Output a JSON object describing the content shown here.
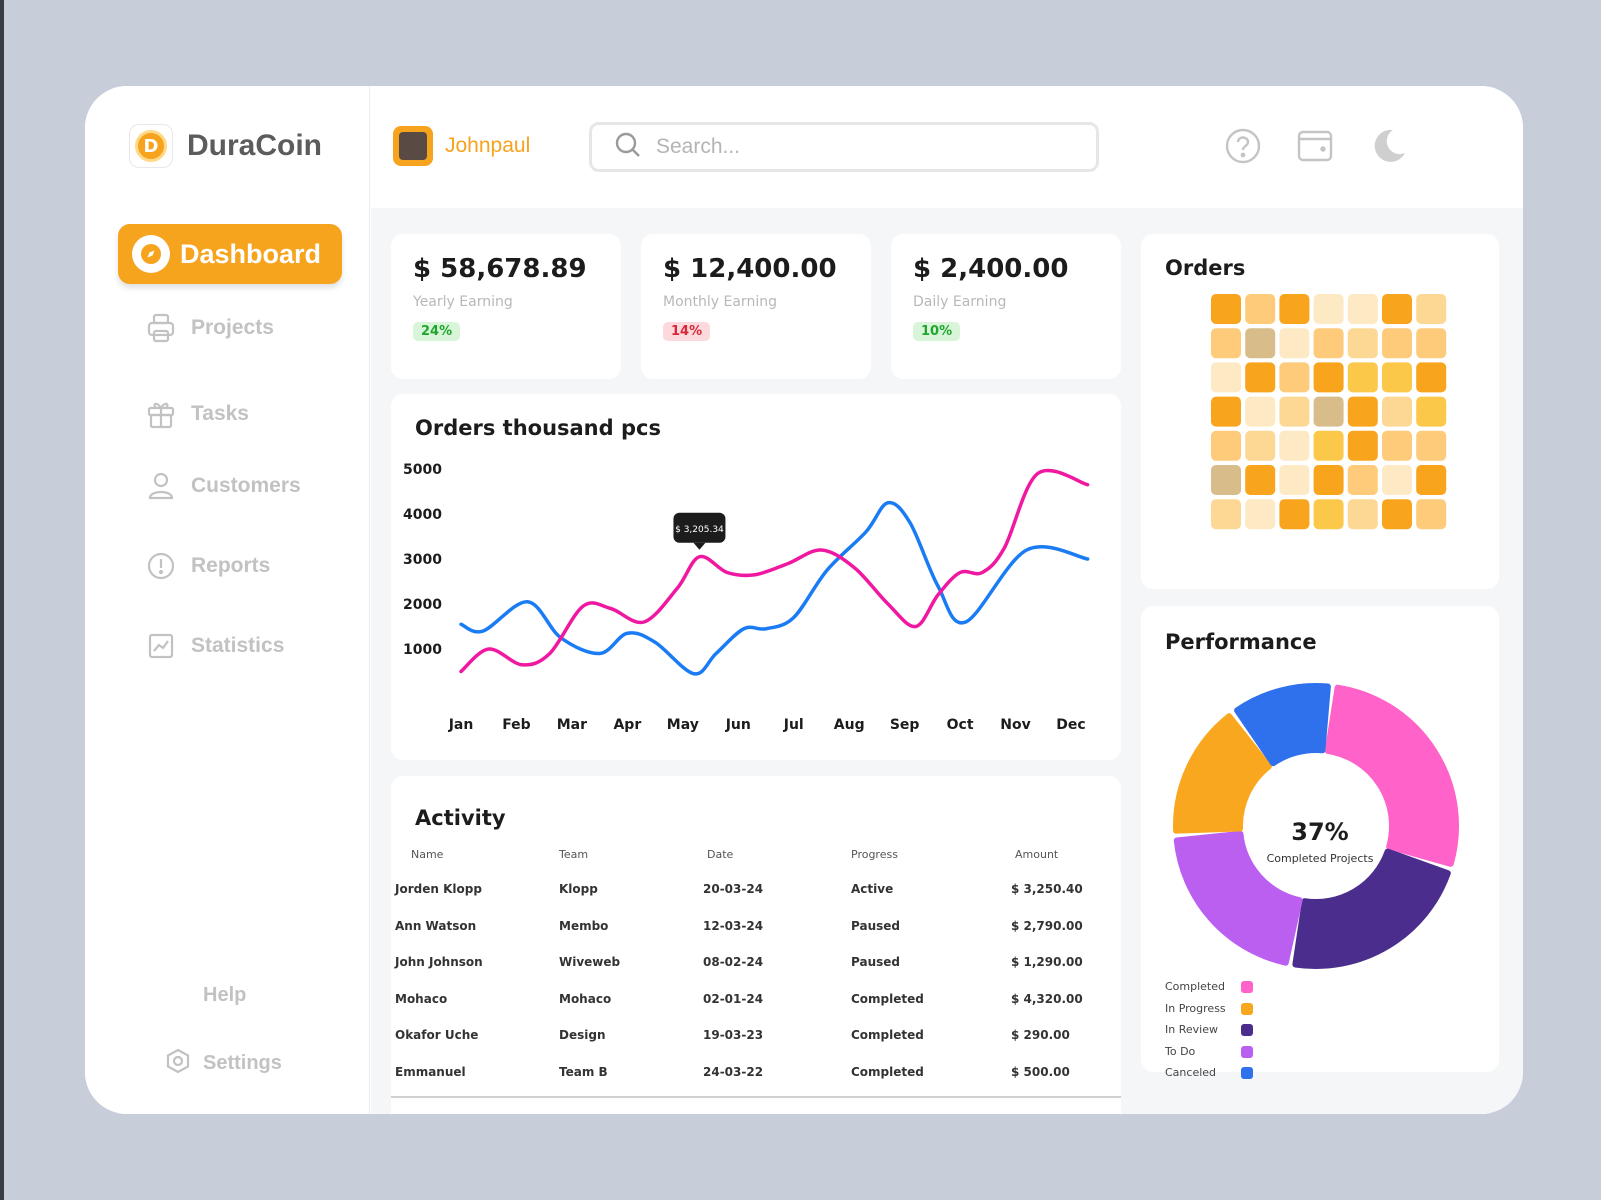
{
  "app": {
    "brand": "DuraCoin",
    "brand_letter": "D"
  },
  "sidebar": {
    "active": {
      "label": "Dashboard"
    },
    "items": [
      {
        "label": "Projects",
        "icon": "printer-icon"
      },
      {
        "label": "Tasks",
        "icon": "gift-icon"
      },
      {
        "label": "Customers",
        "icon": "user-icon"
      },
      {
        "label": "Reports",
        "icon": "alert-circle-icon"
      },
      {
        "label": "Statistics",
        "icon": "chart-icon"
      }
    ],
    "help": "Help",
    "settings": "Settings"
  },
  "header": {
    "user_name": "Johnpaul",
    "search_placeholder": "Search...",
    "icons": [
      "help-icon",
      "wallet-icon",
      "moon-icon"
    ]
  },
  "stats": [
    {
      "value": "$ 58,678.89",
      "label": "Yearly Earning",
      "change": "24%",
      "trend": "up"
    },
    {
      "value": "$ 12,400.00",
      "label": "Monthly Earning",
      "change": "14%",
      "trend": "down"
    },
    {
      "value": "$ 2,400.00",
      "label": "Daily Earning",
      "change": "10%",
      "trend": "up"
    }
  ],
  "orders_heatmap": {
    "title": "Orders",
    "palette": [
      "#fde9c4",
      "#fdd894",
      "#fecb7a",
      "#f8a41c",
      "#fcc84a",
      "#d8bc8a"
    ],
    "cells": [
      [
        3,
        2,
        3,
        0,
        0,
        3,
        1
      ],
      [
        2,
        5,
        0,
        2,
        1,
        2,
        2
      ],
      [
        0,
        3,
        2,
        3,
        4,
        4,
        3
      ],
      [
        3,
        0,
        1,
        5,
        3,
        1,
        4
      ],
      [
        2,
        1,
        0,
        4,
        3,
        2,
        2
      ],
      [
        5,
        3,
        0,
        3,
        2,
        0,
        3
      ],
      [
        1,
        0,
        3,
        4,
        1,
        3,
        2
      ]
    ]
  },
  "chart_data": {
    "type": "line",
    "title": "Orders thousand pcs",
    "categories": [
      "Jan",
      "Feb",
      "Mar",
      "Apr",
      "May",
      "Jun",
      "Jul",
      "Aug",
      "Sep",
      "Oct",
      "Nov",
      "Dec"
    ],
    "y_ticks": [
      5000,
      4000,
      3000,
      2000,
      1000
    ],
    "ylim": [
      0,
      5000
    ],
    "series": [
      {
        "color": "#1a7cf5",
        "x": [
          0,
          0.4,
          1.2,
          1.8,
          2.5,
          3.0,
          3.5,
          4.2,
          4.6,
          5.1,
          5.5,
          6.0,
          6.6,
          7.3,
          7.7,
          8.1,
          8.6,
          9.1,
          10.2,
          11.3
        ],
        "values": [
          1550,
          1400,
          2050,
          1250,
          900,
          1350,
          1150,
          450,
          900,
          1450,
          1450,
          1700,
          2750,
          3600,
          4250,
          3800,
          2400,
          1600,
          3200,
          3000
        ]
      },
      {
        "color": "#f018a0",
        "x": [
          0,
          0.5,
          1.1,
          1.6,
          2.2,
          2.7,
          3.3,
          3.9,
          4.3,
          4.8,
          5.3,
          5.9,
          6.5,
          7.1,
          7.7,
          8.2,
          8.6,
          9.0,
          9.4,
          9.8,
          10.4,
          11.3
        ],
        "values": [
          500,
          1000,
          650,
          900,
          1950,
          1900,
          1600,
          2350,
          3050,
          2700,
          2650,
          2900,
          3200,
          2800,
          2000,
          1500,
          2200,
          2700,
          2700,
          3250,
          4900,
          4650
        ]
      }
    ],
    "tooltip": {
      "text": "$ 3,205.34",
      "x": 4.3,
      "y": 3050
    }
  },
  "activity": {
    "title": "Activity",
    "columns": [
      "Name",
      "Team",
      "Date",
      "Progress",
      "Amount"
    ],
    "rows": [
      [
        "Jorden Klopp",
        "Klopp",
        "20-03-24",
        "Active",
        "$ 3,250.40"
      ],
      [
        "Ann Watson",
        "Membo",
        "12-03-24",
        "Paused",
        "$ 2,790.00"
      ],
      [
        "John Johnson",
        "Wiveweb",
        "08-02-24",
        "Paused",
        "$ 1,290.00"
      ],
      [
        "Mohaco",
        "Mohaco",
        "02-01-24",
        "Completed",
        "$ 4,320.00"
      ],
      [
        "Okafor Uche",
        "Design",
        "19-03-23",
        "Completed",
        "$ 290.00"
      ],
      [
        "Emmanuel",
        "Team B",
        "24-03-22",
        "Completed",
        "$ 500.00"
      ]
    ]
  },
  "performance": {
    "title": "Performance",
    "center_value": "37%",
    "center_label": "Completed Projects",
    "segments": [
      {
        "label": "Completed",
        "color": "#ff62c8",
        "value": 28
      },
      {
        "label": "In Review",
        "color": "#4b2d8e",
        "value": 23
      },
      {
        "label": "To Do",
        "color": "#bb5ff0",
        "value": 21
      },
      {
        "label": "In Progress",
        "color": "#f9a71f",
        "value": 16
      },
      {
        "label": "Canceled",
        "color": "#2f71ec",
        "value": 12
      }
    ],
    "legend": [
      {
        "label": "Completed",
        "color": "#ff62c8"
      },
      {
        "label": "In Progress",
        "color": "#f9a71f"
      },
      {
        "label": "In Review",
        "color": "#4b2d8e"
      },
      {
        "label": "To Do",
        "color": "#bb5ff0"
      },
      {
        "label": "Canceled",
        "color": "#2f71ec"
      }
    ]
  }
}
